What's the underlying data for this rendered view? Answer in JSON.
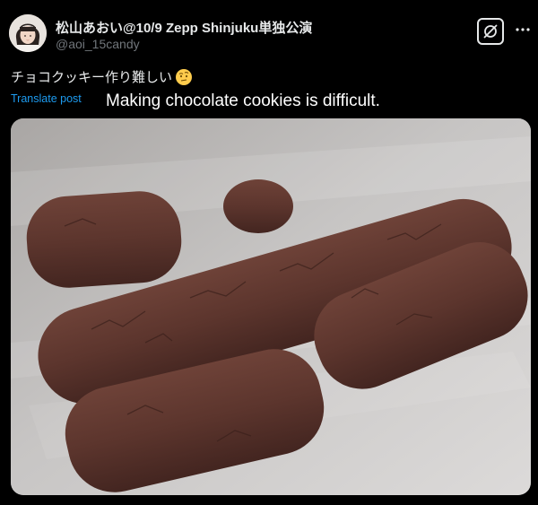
{
  "post": {
    "author": {
      "display_name": "松山あおい@10/9 Zepp Shinjuku単独公演",
      "handle": "@aoi_15candy",
      "avatar_icon": "avatar-photo"
    },
    "text": "チョコクッキー作り難しい",
    "emoji_icon": "face-with-raised-eyebrow-emoji",
    "translate_label": "Translate post",
    "translation": "Making chocolate cookies is difficult.",
    "photo_subject": "chocolate-cookie-dough-logs",
    "actions": {
      "grok_icon": "grok-icon",
      "more_icon": "more-horizontal-icon"
    }
  },
  "colors": {
    "background": "#000000",
    "text_primary": "#e7e9ea",
    "text_secondary": "#71767b",
    "link": "#1d9bf0"
  }
}
